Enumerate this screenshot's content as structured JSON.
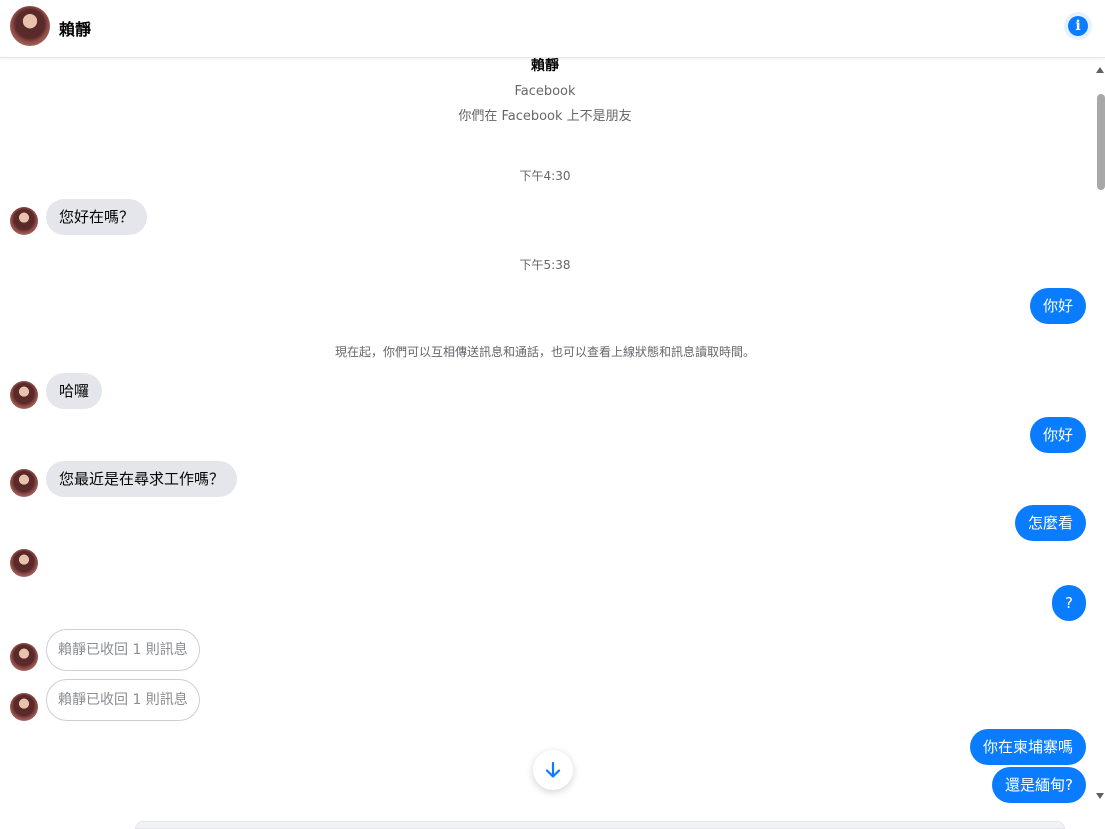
{
  "header": {
    "name": "賴靜",
    "info_icon": "info-icon"
  },
  "profile": {
    "name": "賴靜",
    "source": "Facebook",
    "relationship": "你們在 Facebook 上不是朋友"
  },
  "timestamps": [
    "下午4:30",
    "下午5:38"
  ],
  "notice": "現在起，你們可以互相傳送訊息和通話，也可以查看上線狀態和訊息讀取時間。",
  "messages": {
    "in_1": "您好在嗎？",
    "out_1": "你好",
    "in_2": "哈囉",
    "out_2": "你好",
    "in_3": "您最近是在尋求工作嗎？",
    "out_3": "怎麼看",
    "out_4": "?",
    "recall_1": "賴靜已收回 1 則訊息",
    "recall_2": "賴靜已收回 1 則訊息",
    "out_5": "你在柬埔寨嗎",
    "out_6": "還是緬甸?"
  },
  "colors": {
    "accent": "#0a7cff",
    "incoming_bubble": "#e4e6eb",
    "muted_text": "#65676b"
  },
  "icons": {
    "jump": "arrow-down-icon",
    "scroll_up": "scroll-up-arrow-icon",
    "scroll_down": "scroll-down-arrow-icon"
  }
}
